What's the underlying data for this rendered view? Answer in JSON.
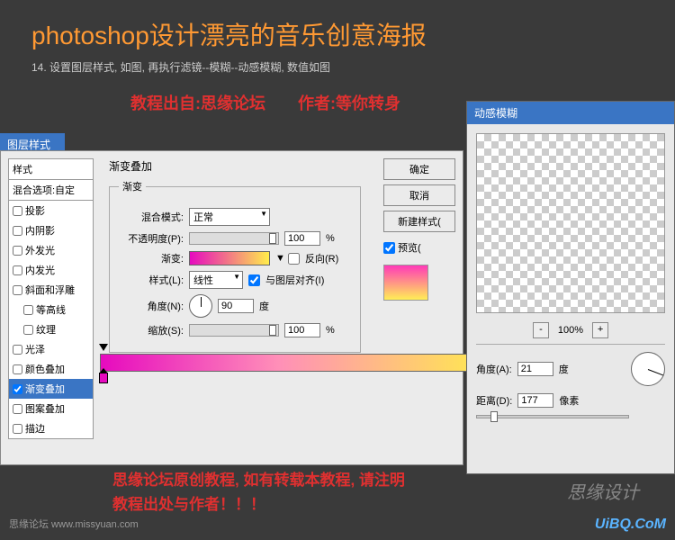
{
  "title": "photoshop设计漂亮的音乐创意海报",
  "subtitle": "14. 设置图层样式, 如图, 再执行滤镜--模糊--动感模糊, 数值如图",
  "credits": "教程出自:思缘论坛　　作者:等你转身",
  "layer_style": {
    "tab": "图层样式",
    "styles_header": "样式",
    "blend_options": "混合选项:自定",
    "items": [
      {
        "label": "投影",
        "checked": false
      },
      {
        "label": "内阴影",
        "checked": false
      },
      {
        "label": "外发光",
        "checked": false
      },
      {
        "label": "内发光",
        "checked": false
      },
      {
        "label": "斜面和浮雕",
        "checked": false
      },
      {
        "label": "等高线",
        "checked": false
      },
      {
        "label": "纹理",
        "checked": false
      },
      {
        "label": "光泽",
        "checked": false
      },
      {
        "label": "颜色叠加",
        "checked": false
      },
      {
        "label": "渐变叠加",
        "checked": true,
        "active": true
      },
      {
        "label": "图案叠加",
        "checked": false
      },
      {
        "label": "描边",
        "checked": false
      }
    ],
    "panel_title": "渐变叠加",
    "fieldset_legend": "渐变",
    "blend_mode_label": "混合模式:",
    "blend_mode_value": "正常",
    "opacity_label": "不透明度(P):",
    "opacity_value": "100",
    "percent": "%",
    "gradient_label": "渐变:",
    "reverse_label": "反向(R)",
    "style_label": "样式(L):",
    "style_value": "线性",
    "align_label": "与图层对齐(I)",
    "angle_label": "角度(N):",
    "angle_value": "90",
    "angle_unit": "度",
    "scale_label": "缩放(S):",
    "scale_value": "100"
  },
  "buttons": {
    "ok": "确定",
    "cancel": "取消",
    "new_style": "新建样式(",
    "preview": "预览("
  },
  "motion_blur": {
    "title": "动感模糊",
    "zoom": "100%",
    "minus": "-",
    "plus": "+",
    "angle_label": "角度(A):",
    "angle_value": "21",
    "angle_unit": "度",
    "distance_label": "距离(D):",
    "distance_value": "177",
    "distance_unit": "像素"
  },
  "footer": {
    "line1": "思缘论坛原创教程, 如有转载本教程, 请注明",
    "line2": "教程出处与作者！！！"
  },
  "watermark": "UiBQ.CoM",
  "corner_logo": "思缘设计",
  "bottom_url": "思缘论坛 www.missyuan.com"
}
